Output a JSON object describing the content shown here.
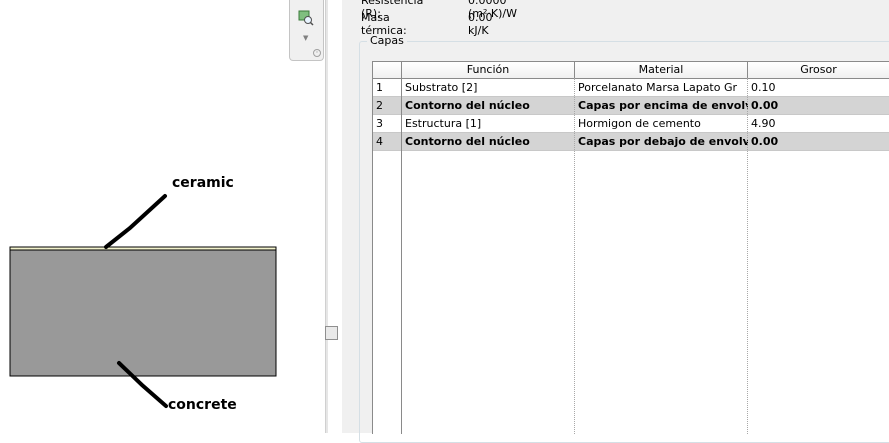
{
  "diagram": {
    "callout_top": "ceramic",
    "callout_bottom": "concrete",
    "colors": {
      "ceramic": "#f2f2cc",
      "concrete": "#999999",
      "outline": "#000000"
    }
  },
  "tool_panel": {
    "icons": [
      "layer-zoom-icon",
      "chevron-down-icon",
      "panel-grip-icon"
    ]
  },
  "properties": {
    "resistance_label": "Resistencia (R):",
    "resistance_value": "0.0000 (m²·K)/W",
    "thermal_mass_label": "Masa térmica:",
    "thermal_mass_value": "0.00 kJ/K"
  },
  "layers_group": {
    "title": "Capas",
    "columns": [
      "",
      "Función",
      "Material",
      "Grosor"
    ],
    "rows": [
      {
        "num": "1",
        "funcion": "Substrato [2]",
        "material": "Porcelanato Marsa Lapato Gr",
        "grosor": "0.10",
        "core": false
      },
      {
        "num": "2",
        "funcion": "Contorno del núcleo",
        "material": "Capas por encima de envolven",
        "grosor": "0.00",
        "core": true
      },
      {
        "num": "3",
        "funcion": "Estructura [1]",
        "material": "Hormigon de cemento",
        "grosor": "4.90",
        "core": false
      },
      {
        "num": "4",
        "funcion": "Contorno del núcleo",
        "material": "Capas por debajo de envolvent",
        "grosor": "0.00",
        "core": true
      }
    ],
    "core_row_color": "#d4d4d4"
  }
}
